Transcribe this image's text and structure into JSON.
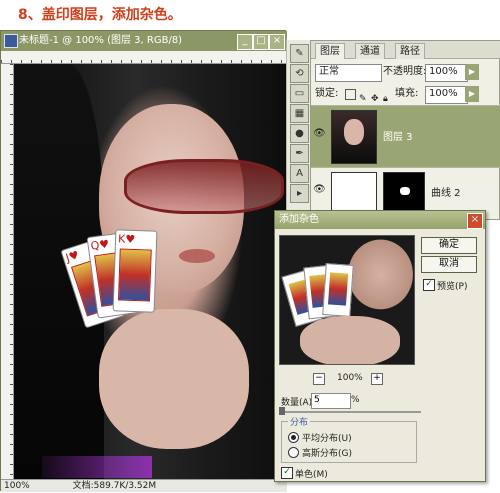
{
  "caption": "8、盖印图层，添加杂色。",
  "document": {
    "title": "未标题-1 @ 100% (图层 3, RGB/8)",
    "zoom": "100%",
    "status": "文档:589.7K/3.52M"
  },
  "toolbar": {
    "icons": [
      "brush-icon",
      "history-brush-icon",
      "eraser-icon",
      "gradient-icon",
      "dodge-icon",
      "pen-icon",
      "type-icon",
      "path-select-icon"
    ]
  },
  "layers_panel": {
    "tabs": [
      "图层",
      "通道",
      "路径"
    ],
    "blend_mode": "正常",
    "opacity_label": "不透明度:",
    "opacity_value": "100%",
    "lock_label": "锁定:",
    "fill_label": "填充:",
    "fill_value": "100%",
    "layers": [
      {
        "name": "图层 3"
      },
      {
        "name": "曲线 2"
      }
    ]
  },
  "add_noise_dialog": {
    "title": "添加杂色",
    "ok_label": "确定",
    "cancel_label": "取消",
    "preview_label": "预览(P)",
    "preview_checked": true,
    "zoom_value": "100%",
    "amount_label": "数量(A):",
    "amount_value": "5",
    "amount_unit": "%",
    "distribution_label": "分布",
    "uniform_label": "平均分布(U)",
    "gaussian_label": "高斯分布(G)",
    "selected_distribution": "uniform",
    "monochromatic_label": "单色(M)",
    "monochromatic_checked": true
  },
  "colors": {
    "title_bar": "#8b9865",
    "panel_accent": "#9aa574",
    "caption_red": "#d23e1b"
  }
}
